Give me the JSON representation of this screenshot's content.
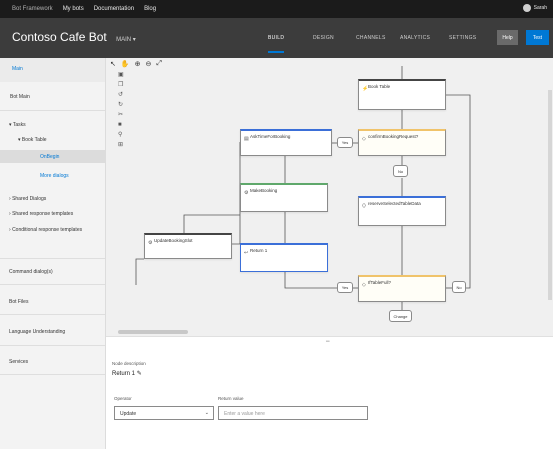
{
  "topbar": {
    "brand": "Bot Framework",
    "links": [
      "My bots",
      "Documentation",
      "Blog"
    ],
    "user": "Sarah"
  },
  "appbar": {
    "title": "Contoso Cafe Bot",
    "title_menu": "MAIN ▾",
    "tabs": [
      "BUILD",
      "DESIGN",
      "CHANNELS",
      "ANALYTICS",
      "SETTINGS"
    ],
    "help_label": "Help",
    "test_label": "Test"
  },
  "leftnav": {
    "filter_label": "Main",
    "bot_root": "Bot Main",
    "tasks_label": "Tasks",
    "task_name": "Book Table",
    "sub_selected": "OnBegin",
    "sub_other": "More dialogs",
    "shared_dialogs": "Shared Dialogs",
    "lg_templates": "Shared response templates",
    "dialog_lg": "Conditional response templates",
    "sections": [
      "Command dialog(s)",
      "Bot Files",
      "Language Understanding",
      "Services"
    ]
  },
  "canvas": {
    "toolbar_icons": [
      "cursor-icon",
      "pan-icon",
      "zoom-in-icon",
      "zoom-out-icon",
      "fit-icon"
    ],
    "toolstrip_icons": [
      "save-icon",
      "copy-icon",
      "undo-icon",
      "redo-icon",
      "cut-icon",
      "delete-icon",
      "link-icon",
      "lock-icon"
    ],
    "nodes": {
      "start": "Book Table",
      "ask_time": "AskTimeForBooking",
      "confirm_q": "confirmBookingRequest?",
      "make_booking": "MakeBooking",
      "set_table": "UpdateBookingSlot",
      "reserve": "reserveSelectedTableData",
      "return": "Return 1",
      "if_table": "IfTableFull?",
      "cancel_branch": "Cancel"
    },
    "pills": {
      "yes1": "Yes",
      "no1": "No",
      "yes2": "Yes",
      "no2": "No",
      "change": "Change"
    },
    "collapse_handle": "═"
  },
  "props": {
    "node_label": "Node description",
    "node_value": "Return 1",
    "operator_label": "Operator",
    "operator_value": "Update",
    "value_label": "Return value",
    "value_placeholder": "Enter a value here"
  }
}
